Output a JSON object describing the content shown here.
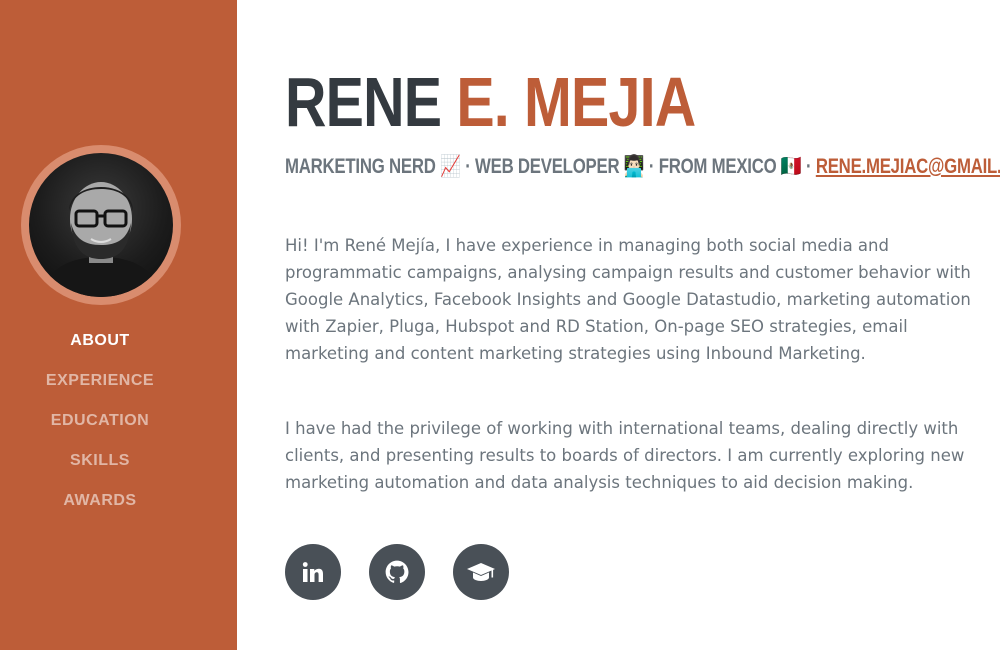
{
  "profile": {
    "first_name": "RENE ",
    "last_name": "E. MEJIA",
    "avatar_alt": "profile photo"
  },
  "subheading": {
    "part1": "MARKETING NERD",
    "emoji1": "📈",
    "sep1": " · WEB DEVELOPER",
    "emoji2": "👨🏻‍💻",
    "sep2": " · FROM MEXICO",
    "emoji3": "🇲🇽",
    "sep3": " · ",
    "email": "RENE.MEJIAC@GMAIL.COM"
  },
  "nav": {
    "items": [
      {
        "label": "ABOUT"
      },
      {
        "label": "EXPERIENCE"
      },
      {
        "label": "EDUCATION"
      },
      {
        "label": "SKILLS"
      },
      {
        "label": "AWARDS"
      }
    ]
  },
  "about": {
    "paragraph1": "Hi! I'm René Mejía, I have experience in managing both social media and programmatic campaigns, analysing campaign results and customer behavior with Google Analytics, Facebook Insights and Google Datastudio, marketing automation with Zapier, Pluga, Hubspot and RD Station, On-page SEO strategies, email marketing and content marketing strategies using Inbound Marketing.",
    "paragraph2": "I have had the privilege of working with international teams, dealing directly with clients, and presenting results to boards of directors. I am currently exploring new marketing automation and data analysis techniques to aid decision making."
  },
  "social": {
    "icons": [
      "linkedin-icon",
      "github-icon",
      "graduation-cap-icon"
    ]
  },
  "colors": {
    "primary": "#bd5d38",
    "dark": "#343a40",
    "muted": "#6c757d",
    "social_bg": "#495057"
  }
}
